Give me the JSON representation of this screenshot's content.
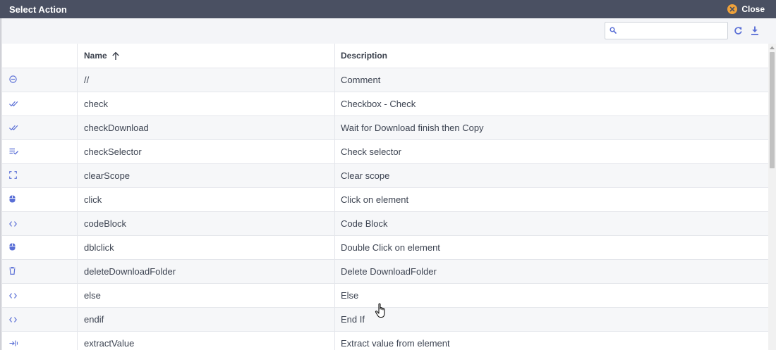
{
  "dialog": {
    "title": "Select Action",
    "close_label": "Close"
  },
  "toolbar": {
    "search_value": "",
    "search_placeholder": "",
    "icons": [
      "search-icon",
      "refresh-icon",
      "download-icon"
    ]
  },
  "table": {
    "columns": [
      {
        "key": "icon",
        "label": ""
      },
      {
        "key": "name",
        "label": "Name",
        "sort": "ascending"
      },
      {
        "key": "description",
        "label": "Description"
      }
    ],
    "rows": [
      {
        "icon": "minus-circle-icon",
        "name": "//",
        "description": "Comment"
      },
      {
        "icon": "double-check-icon",
        "name": "check",
        "description": "Checkbox - Check"
      },
      {
        "icon": "double-check-icon",
        "name": "checkDownload",
        "description": "Wait for Download finish then Copy"
      },
      {
        "icon": "list-check-icon",
        "name": "checkSelector",
        "description": "Check selector"
      },
      {
        "icon": "scope-frame-icon",
        "name": "clearScope",
        "description": "Clear scope"
      },
      {
        "icon": "mouse-icon",
        "name": "click",
        "description": "Click on element"
      },
      {
        "icon": "code-icon",
        "name": "codeBlock",
        "description": "Code Block"
      },
      {
        "icon": "mouse-icon",
        "name": "dblclick",
        "description": "Double Click on element"
      },
      {
        "icon": "trash-icon",
        "name": "deleteDownloadFolder",
        "description": "Delete DownloadFolder"
      },
      {
        "icon": "code-icon",
        "name": "else",
        "description": "Else"
      },
      {
        "icon": "code-icon",
        "name": "endif",
        "description": "End If"
      },
      {
        "icon": "arrow-into-icon",
        "name": "extractValue",
        "description": "Extract value from element"
      }
    ]
  },
  "colors": {
    "titlebar": "#4a5062",
    "close_accent": "#f0a23a",
    "icon_accent": "#5a6fd6",
    "toolbar_bg": "#f4f5f8",
    "row_alt": "#f6f7f9"
  }
}
